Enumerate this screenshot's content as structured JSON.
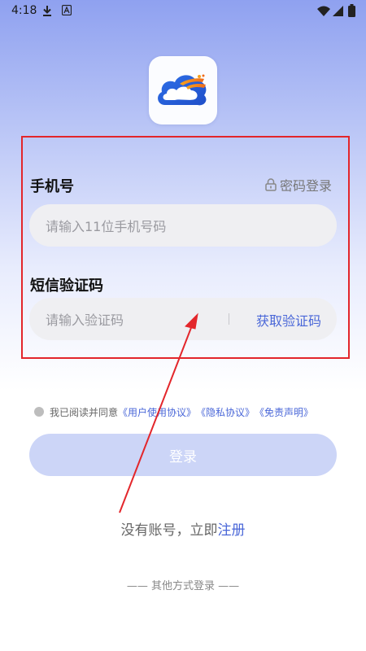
{
  "status_bar": {
    "time": "4:18",
    "icons": [
      "download-icon",
      "notification-a-icon",
      "wifi-icon",
      "signal-icon",
      "battery-icon"
    ]
  },
  "app": {
    "logo_icon": "cloud-logo-icon"
  },
  "form": {
    "phone_label": "手机号",
    "password_login_label": "密码登录",
    "phone_placeholder": "请输入11位手机号码",
    "code_label": "短信验证码",
    "code_placeholder": "请输入验证码",
    "get_code_label": "获取验证码"
  },
  "agreement": {
    "prefix": "我已阅读并同意",
    "user_agreement": "《用户使用协议》",
    "privacy": "《隐私协议》",
    "disclaimer": "《免责声明》"
  },
  "login_button_label": "登录",
  "register": {
    "prefix": "没有账号，立即",
    "link": "注册"
  },
  "other_login_label": "—— 其他方式登录 ——",
  "colors": {
    "accent": "#4a67d8",
    "button_disabled": "#ccd5f7",
    "highlight_box": "#e3262b"
  }
}
